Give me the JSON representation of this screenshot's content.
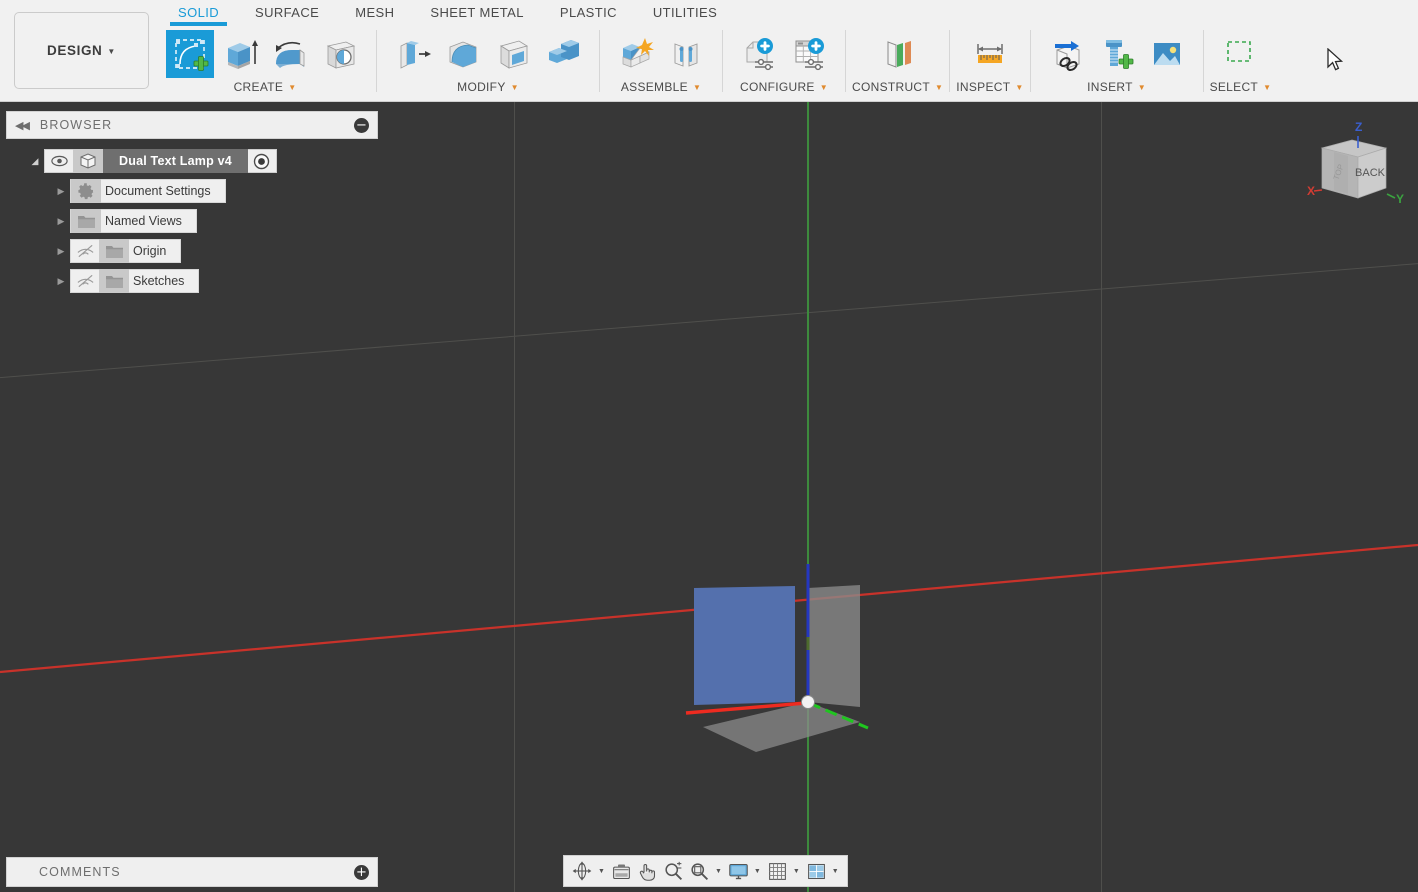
{
  "app": {
    "workspace_label": "DESIGN",
    "viewport_bg": "#373737",
    "accent": "#1a9bd7",
    "panel_bg": "#f1f1f1"
  },
  "tabs": [
    {
      "label": "SOLID",
      "active": true
    },
    {
      "label": "SURFACE",
      "active": false
    },
    {
      "label": "MESH",
      "active": false
    },
    {
      "label": "SHEET METAL",
      "active": false
    },
    {
      "label": "PLASTIC",
      "active": false
    },
    {
      "label": "UTILITIES",
      "active": false
    }
  ],
  "panels": [
    {
      "label": "CREATE",
      "tools": [
        "create-sketch-icon",
        "extrude-icon",
        "revolve-icon",
        "hole-icon"
      ]
    },
    {
      "label": "MODIFY",
      "tools": [
        "press-pull-icon",
        "fillet-icon",
        "shell-icon",
        "combine-icon"
      ]
    },
    {
      "label": "ASSEMBLE",
      "tools": [
        "new-component-icon",
        "joint-icon"
      ]
    },
    {
      "label": "CONFIGURE",
      "tools": [
        "configure-design-icon",
        "configure-table-icon"
      ]
    },
    {
      "label": "CONSTRUCT",
      "tools": [
        "offset-plane-icon"
      ]
    },
    {
      "label": "INSPECT",
      "tools": [
        "measure-icon"
      ]
    },
    {
      "label": "INSERT",
      "tools": [
        "insert-derive-icon",
        "insert-mcmaster-icon",
        "insert-canvas-icon"
      ]
    },
    {
      "label": "SELECT",
      "tools": [
        "select-window-icon"
      ]
    }
  ],
  "browser": {
    "title": "BROWSER",
    "collapse_icon": "collapse-left-icon",
    "minimize_icon": "minus-circle-icon",
    "tree": [
      {
        "label": "Dual Text Lamp v4",
        "is_root": true,
        "expanded": true,
        "icon": "component-icon",
        "visibility_icon": "eye-icon",
        "activate_icon": "radio-active-icon"
      },
      {
        "label": "Document Settings",
        "is_root": false,
        "expanded": false,
        "icon": "gear-icon",
        "visibility_icon": null
      },
      {
        "label": "Named Views",
        "is_root": false,
        "expanded": false,
        "icon": "folder-icon",
        "visibility_icon": null
      },
      {
        "label": "Origin",
        "is_root": false,
        "expanded": false,
        "icon": "folder-icon",
        "visibility_icon": "eye-hidden-icon"
      },
      {
        "label": "Sketches",
        "is_root": false,
        "expanded": false,
        "icon": "folder-icon",
        "visibility_icon": "eye-hidden-icon"
      }
    ]
  },
  "viewcube": {
    "face_label": "BACK",
    "side_label": "TOP",
    "axis_x": "X",
    "axis_y": "Y",
    "axis_z": "Z",
    "axis_x_color": "#d33c33",
    "axis_y_color": "#3ba340",
    "axis_z_color": "#3a5fd0"
  },
  "viewport": {
    "origin_planes": [
      {
        "name": "xz-plane-highlighted",
        "color": "#5470ad",
        "highlighted": true
      },
      {
        "name": "yz-plane",
        "color": "#8b8b8b",
        "highlighted": false
      },
      {
        "name": "xy-plane",
        "color": "#909090",
        "highlighted": false
      }
    ],
    "axes": [
      {
        "name": "x-axis",
        "color": "#e02b20"
      },
      {
        "name": "y-axis",
        "color": "#1fc61f"
      },
      {
        "name": "z-axis",
        "color": "#2b41c8"
      }
    ],
    "origin_point": "origin-point"
  },
  "navbar": {
    "items": [
      {
        "icon": "orbit-icon",
        "has_caret": true
      },
      {
        "icon": "look-at-icon",
        "has_caret": false
      },
      {
        "icon": "pan-icon",
        "has_caret": false
      },
      {
        "icon": "zoom-icon",
        "has_caret": false
      },
      {
        "icon": "zoom-window-icon",
        "has_caret": true
      },
      {
        "icon": "display-settings-icon",
        "has_caret": true
      },
      {
        "icon": "grid-snaps-icon",
        "has_caret": true
      },
      {
        "icon": "viewport-layout-icon",
        "has_caret": true
      }
    ]
  },
  "comments": {
    "title": "COMMENTS",
    "add_icon": "plus-circle-icon"
  },
  "cursor": {
    "icon": "mouse-pointer-icon"
  }
}
